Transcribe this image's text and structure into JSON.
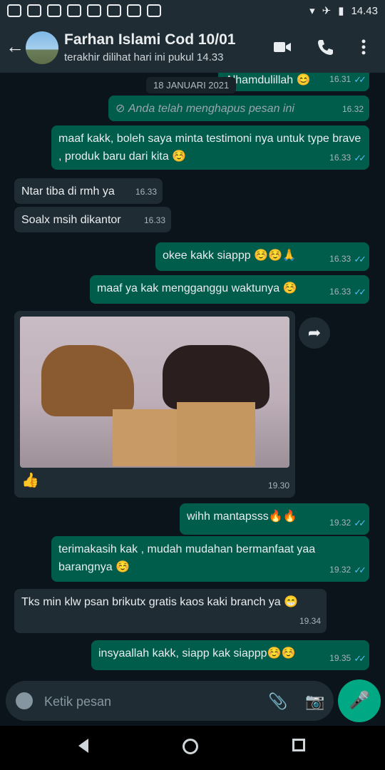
{
  "status": {
    "time": "14.43"
  },
  "header": {
    "title": "Farhan Islami Cod 10/01",
    "subtitle": "terakhir dilihat hari ini pukul 14.33"
  },
  "chat": {
    "date_chip": "18 JANUARI 2021",
    "messages": [
      {
        "id": "m1",
        "text": "Alhamdulillah 😊",
        "time": "16.31",
        "dir": "out"
      },
      {
        "id": "m2",
        "text": "Anda telah menghapus pesan ini",
        "time": "16.32",
        "dir": "out",
        "deleted": true
      },
      {
        "id": "m3",
        "text": "maaf kakk, boleh saya minta testimoni nya untuk type brave , produk baru dari kita ☺️",
        "time": "16.33",
        "dir": "out"
      },
      {
        "id": "m4",
        "text": "Ntar tiba di rmh ya",
        "time": "16.33",
        "dir": "in"
      },
      {
        "id": "m5",
        "text": "Soalx msih dikantor",
        "time": "16.33",
        "dir": "in"
      },
      {
        "id": "m6",
        "text": "okee kakk siappp ☺️☺️🙏",
        "time": "16.33",
        "dir": "out"
      },
      {
        "id": "m7",
        "text": "maaf ya kak mengganggu waktunya ☺️",
        "time": "16.33",
        "dir": "out"
      },
      {
        "id": "m8",
        "text": "👍",
        "time": "19.30",
        "dir": "in"
      },
      {
        "id": "m9",
        "text": "wihh mantapsss🔥🔥",
        "time": "19.32",
        "dir": "out"
      },
      {
        "id": "m10",
        "text": "terimakasih kak , mudah mudahan bermanfaat yaa barangnya ☺️",
        "time": "19.32",
        "dir": "out"
      },
      {
        "id": "m11",
        "text": "Tks min klw psan brikutx gratis kaos kaki branch ya 😁",
        "time": "19.34",
        "dir": "in"
      },
      {
        "id": "m12",
        "text": "insyaallah kakk, siapp kak siappp☺️☺️",
        "time": "19.35",
        "dir": "out"
      }
    ]
  },
  "composer": {
    "placeholder": "Ketik pesan"
  },
  "icons": {
    "back": "arrow-left-icon",
    "video": "video-call-icon",
    "call": "phone-icon",
    "menu": "more-vertical-icon",
    "emoji": "emoji-icon",
    "attach": "paperclip-icon",
    "camera": "camera-icon",
    "mic": "microphone-icon",
    "forward": "forward-icon"
  },
  "colors": {
    "outgoing": "#005c4b",
    "incoming": "#202c33",
    "accent": "#00a884",
    "ticks": "#53bdeb"
  }
}
